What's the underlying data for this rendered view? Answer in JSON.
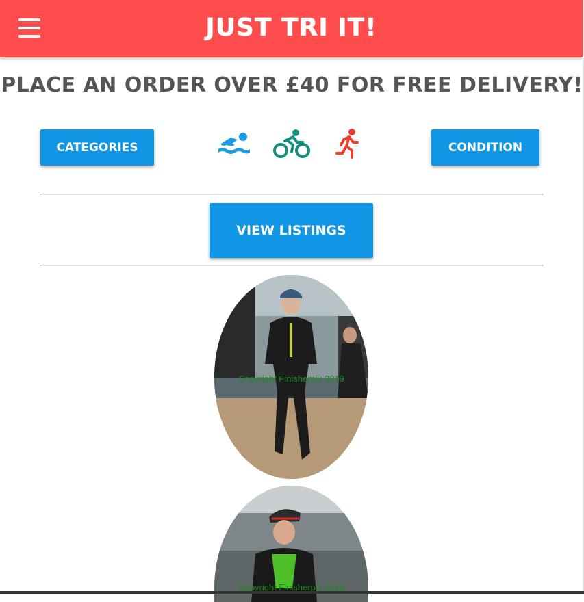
{
  "header": {
    "title": "Just Tri It!",
    "menu_icon": "hamburger-menu-icon",
    "color": "#ff4c4c"
  },
  "promo": {
    "text": "Place an order over £40 for free delivery!"
  },
  "buttons": {
    "categories": "Categories",
    "condition": "Condition",
    "view_listings": "View Listings",
    "color": "#1196e6"
  },
  "sports": [
    {
      "icon": "swim-icon",
      "color": "#1b9ae6"
    },
    {
      "icon": "bike-icon",
      "color": "#12907c"
    },
    {
      "icon": "run-icon",
      "color": "#e8402c"
    }
  ],
  "listings": [
    {
      "watermark": "Copyright Finisherpix 2019"
    },
    {
      "watermark": "Copyright Finisherpix 2019"
    }
  ]
}
